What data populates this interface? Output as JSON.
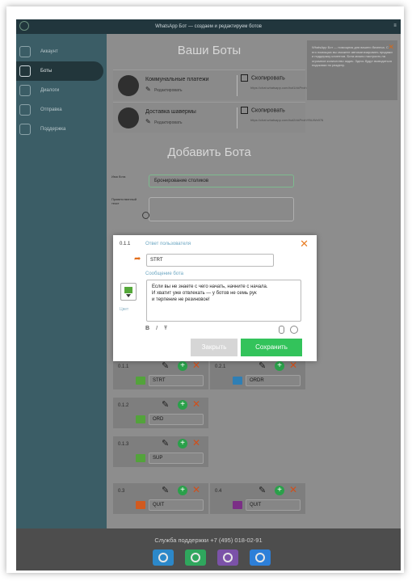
{
  "app": {
    "title": "WhatsApp Бот — создаем и редактируем ботов"
  },
  "sidebar": {
    "items": [
      {
        "label": "Аккаунт",
        "icon": "user-icon"
      },
      {
        "label": "Боты",
        "icon": "robot-icon",
        "active": true
      },
      {
        "label": "Диалоги",
        "icon": "chat-icon"
      },
      {
        "label": "Отправка",
        "icon": "broadcast-icon"
      },
      {
        "label": "Поддержка",
        "icon": "support-icon"
      }
    ]
  },
  "bots_section": {
    "title": "Ваши Боты",
    "bots": [
      {
        "name": "Коммунальные платежи",
        "edit_label": "Редактировать",
        "copy_label": "Скопировать",
        "url": "https://chat.whatsapp.com/bot1/ckPnxhYBUWx976"
      },
      {
        "name": "Доставка шавермы",
        "edit_label": "Редактировать",
        "copy_label": "Скопировать",
        "url": "https://chat.whatsapp.com/bot2/ckPnxhYBUWx976"
      }
    ]
  },
  "tip": {
    "text": "WhatsApp Бот — помощник для вашего бизнеса. С его помощью вы сможете автоматизировать продажи и поддержку клиентов. Бота можно настроить на огромное количество задач. Здесь будут выводиться подсказки по разделу."
  },
  "add_bot": {
    "title": "Добавить Бота",
    "name_label": "Имя бота",
    "name_value": "Бронирование столиков",
    "greeting_label": "Приветственный текст"
  },
  "modal": {
    "number": "0.1.1",
    "answer_label": "Ответ пользователя",
    "answer_value": "STRT",
    "message_label": "Сообщение бота",
    "message_lines": [
      "Если вы не знаете с чего начать, начните с начала.",
      "И хватит уже отвлекать — у ботов не семь рук",
      "и терпение не резиновое!"
    ],
    "color_label": "Цвет",
    "color_value": "#55a83a",
    "format": {
      "bold": "B",
      "italic": "I",
      "strike": "Ŧ"
    },
    "close_label": "Закрыть",
    "save_label": "Сохранить"
  },
  "nodes": [
    {
      "num": "0.1.1",
      "cmd": "STRT",
      "color": "#53a33b"
    },
    {
      "num": "0.2.1",
      "cmd": "ORDR",
      "color": "#2f7fb5"
    },
    {
      "num": "0.1.2",
      "cmd": "ORD",
      "color": "#53a33b"
    },
    {
      "num": "0.1.3",
      "cmd": "SUP",
      "color": "#53a33b"
    },
    {
      "num": "0.3",
      "cmd": "QUIT",
      "color": "#d15a1f"
    },
    {
      "num": "0.4",
      "cmd": "QUIT",
      "color": "#7b2f86"
    }
  ],
  "footer": {
    "support_text": "Служба поддержки +7 (495) 018-02-91",
    "channels": [
      {
        "name": "telegram-icon",
        "color": "#2c88c9"
      },
      {
        "name": "whatsapp-icon",
        "color": "#2fa65d"
      },
      {
        "name": "viber-icon",
        "color": "#7b52a8"
      },
      {
        "name": "messenger-icon",
        "color": "#2d7fd8"
      }
    ]
  }
}
